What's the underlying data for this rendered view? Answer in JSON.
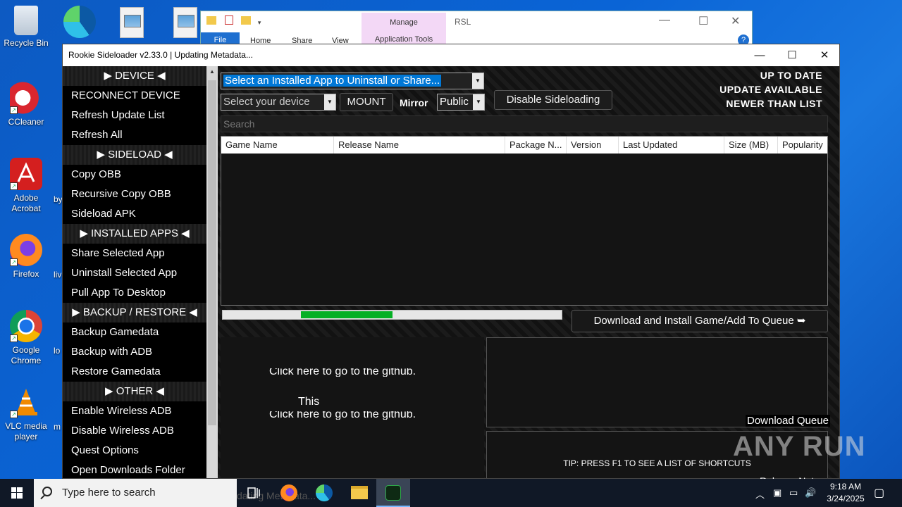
{
  "desktop": {
    "icons": [
      {
        "label": "Recycle Bin"
      },
      {
        "label": "CCleaner"
      },
      {
        "label": "Adobe Acrobat"
      },
      {
        "label": "Firefox"
      },
      {
        "label": "Google Chrome"
      },
      {
        "label": "VLC media player"
      }
    ],
    "partial_labels": {
      "by": "by",
      "liv": "liv",
      "lo": "lo",
      "m": "m"
    }
  },
  "explorer": {
    "file_tab": "File",
    "home_tab": "Home",
    "share_tab": "Share",
    "view_tab": "View",
    "manage_label": "Manage",
    "app_tools_tab": "Application Tools",
    "title": "RSL"
  },
  "window": {
    "title": "Rookie Sideloader v2.33.0 | Updating Metadata...",
    "minimize": "—",
    "maximize": "☐",
    "close": "✕"
  },
  "sidebar": {
    "sections": [
      {
        "header": "▶ DEVICE ◀",
        "items": [
          "RECONNECT DEVICE",
          "Refresh Update List",
          "Refresh All"
        ]
      },
      {
        "header": "▶ SIDELOAD ◀",
        "items": [
          "Copy OBB",
          "Recursive Copy OBB",
          "Sideload APK"
        ]
      },
      {
        "header": "▶ INSTALLED APPS ◀",
        "items": [
          "Share Selected App",
          "Uninstall Selected App",
          "Pull App To Desktop"
        ]
      },
      {
        "header": "▶ BACKUP / RESTORE ◀",
        "items": [
          "Backup Gamedata",
          "Backup with ADB",
          "Restore Gamedata"
        ]
      },
      {
        "header": "▶ OTHER ◀",
        "items": [
          "Enable Wireless ADB",
          "Disable Wireless ADB",
          "Quest Options",
          "Open Downloads Folder"
        ]
      }
    ]
  },
  "toolbar": {
    "installed_app_select": "Select an Installed App to Uninstall or Share...",
    "device_select": "Select your device",
    "mount_button": "MOUNT",
    "mirror_label": "Mirror",
    "mirror_select": "Public",
    "disable_sideloading_button": "Disable Sideloading"
  },
  "status": {
    "up_to_date": "UP TO DATE",
    "update_available": "UPDATE AVAILABLE",
    "newer_than_list": "NEWER THAN LIST"
  },
  "search": {
    "placeholder": "Search"
  },
  "table": {
    "columns": [
      "Game Name",
      "Release Name",
      "Package N...",
      "Version",
      "Last Updated",
      "Size (MB)",
      "Popularity"
    ],
    "rows": []
  },
  "progress": {
    "start_fraction": 0.23,
    "end_fraction": 0.5
  },
  "download_button": "Download and Install Game/Add To Queue ➥",
  "notes": {
    "github_line_1": "Click here to go to the github.",
    "this_text": "This",
    "github_line_2": "Click here to go to the github."
  },
  "queue": {
    "label": "Download Queue",
    "tip": "TIP: PRESS F1 TO SEE A LIST OF SHORTCUTS",
    "release_notes_label": "Release Notes"
  },
  "watermark": "ANY RUN",
  "taskbar": {
    "search_placeholder": "Type here to search",
    "ghost_text": "dating Metadata...",
    "time": "9:18 AM",
    "date": "3/24/2025"
  }
}
